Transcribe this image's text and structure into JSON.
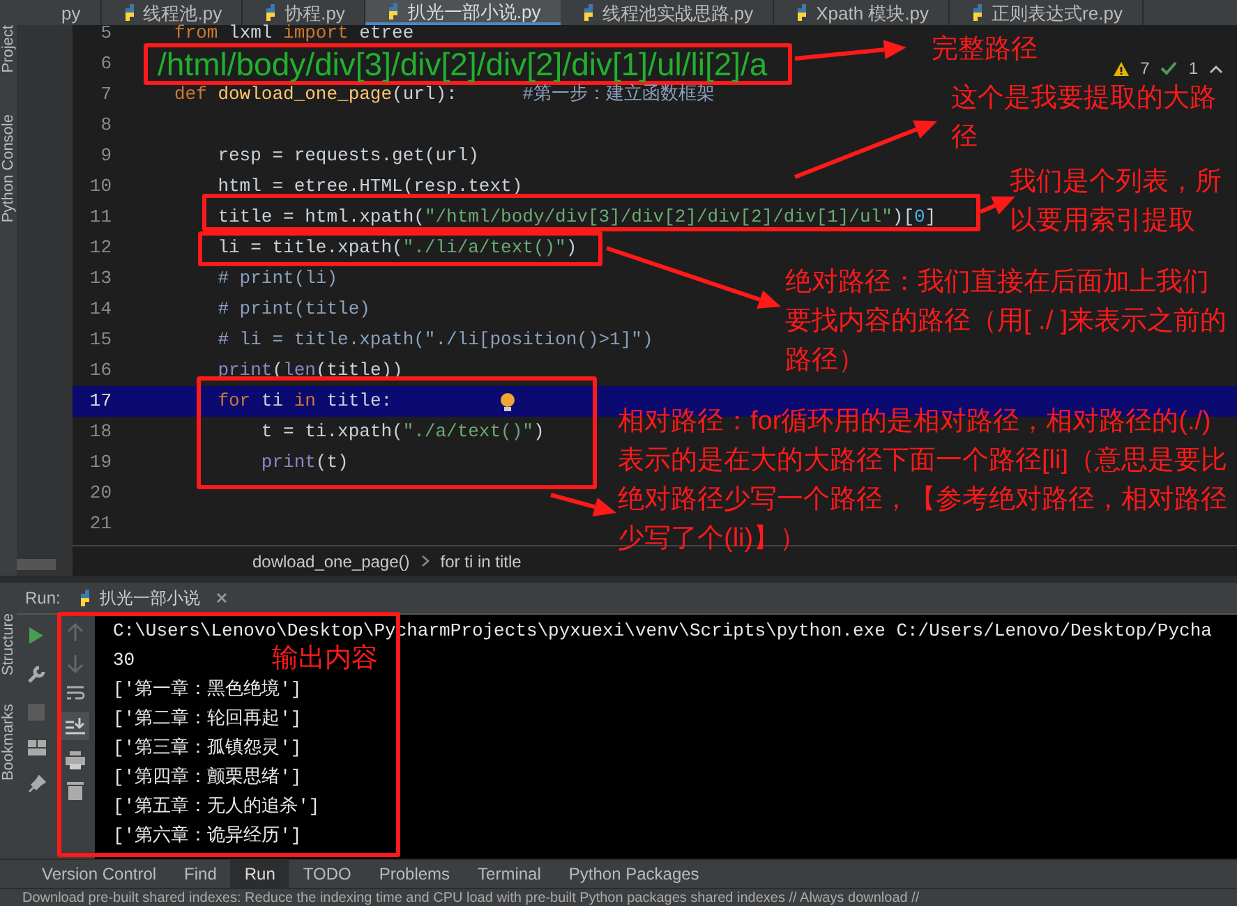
{
  "tabs": [
    {
      "label": "py",
      "selected": false
    },
    {
      "label": "线程池.py",
      "selected": false
    },
    {
      "label": "协程.py",
      "selected": false
    },
    {
      "label": "扒光一部小说.py",
      "selected": true
    },
    {
      "label": "线程池实战思路.py",
      "selected": false
    },
    {
      "label": "Xpath 模块.py",
      "selected": false
    },
    {
      "label": "正则表达式re.py",
      "selected": false
    }
  ],
  "side_labels_top": [
    "Project",
    "Python Console"
  ],
  "inspections": {
    "warnings": "7",
    "passed": "1"
  },
  "code_lines": [
    {
      "number": "5",
      "current": false,
      "segments": [
        {
          "text": "from",
          "kind": "keyword"
        },
        {
          "text": " lxml ",
          "kind": "plain"
        },
        {
          "text": "import",
          "kind": "keyword"
        },
        {
          "text": " etree",
          "kind": "plain"
        }
      ]
    },
    {
      "number": "6",
      "current": false,
      "segments": [
        {
          "text": "/html/body/div[3]/div[2]/div[2]/div[1]/ul/li[2]/a",
          "kind": "annotation"
        }
      ]
    },
    {
      "number": "7",
      "current": false,
      "segments": [
        {
          "text": "def",
          "kind": "keyword"
        },
        {
          "text": " dowload_one_page",
          "kind": "function"
        },
        {
          "text": "(url):",
          "kind": "plain"
        },
        {
          "text": "      #第一步：建立函数框架",
          "kind": "comment"
        }
      ]
    },
    {
      "number": "8",
      "current": false
    },
    {
      "number": "9",
      "current": false,
      "segments": [
        {
          "text": "    resp = requests.get(url)",
          "kind": "plain"
        }
      ]
    },
    {
      "number": "10",
      "current": false,
      "segments": [
        {
          "text": "    html = etree.HTML(resp.text)",
          "kind": "plain"
        }
      ]
    },
    {
      "number": "11",
      "current": false,
      "segments": [
        {
          "text": "    title = html.xpath(",
          "kind": "plain"
        },
        {
          "text": "\"/html/body/div[3]/div[2]/div[2]/div[1]/ul\"",
          "kind": "string"
        },
        {
          "text": ")[",
          "kind": "plain"
        },
        {
          "text": "0",
          "kind": "number"
        },
        {
          "text": "]",
          "kind": "plain"
        }
      ]
    },
    {
      "number": "12",
      "current": false,
      "segments": [
        {
          "text": "    li = title.xpath(",
          "kind": "plain"
        },
        {
          "text": "\"./li/a/text()\"",
          "kind": "string"
        },
        {
          "text": ")",
          "kind": "plain"
        }
      ]
    },
    {
      "number": "13",
      "current": false,
      "segments": [
        {
          "text": "    # print(li)",
          "kind": "comment"
        }
      ]
    },
    {
      "number": "14",
      "current": false,
      "segments": [
        {
          "text": "    # print(title)",
          "kind": "comment"
        }
      ]
    },
    {
      "number": "15",
      "current": false,
      "segments": [
        {
          "text": "    # li = title.xpath(\"./li[position()>1]\")",
          "kind": "comment"
        }
      ]
    },
    {
      "number": "16",
      "current": false,
      "segments": [
        {
          "text": "    print",
          "kind": "builtin"
        },
        {
          "text": "(",
          "kind": "plain"
        },
        {
          "text": "len",
          "kind": "builtin"
        },
        {
          "text": "(title))",
          "kind": "plain"
        }
      ]
    },
    {
      "number": "17",
      "current": true,
      "segments": [
        {
          "text": "    for",
          "kind": "keyword"
        },
        {
          "text": " ti ",
          "kind": "plain"
        },
        {
          "text": "in",
          "kind": "keyword"
        },
        {
          "text": " title:",
          "kind": "plain"
        }
      ]
    },
    {
      "number": "18",
      "current": false,
      "segments": [
        {
          "text": "        t = ti.xpath(",
          "kind": "plain"
        },
        {
          "text": "\"./a/text()\"",
          "kind": "string"
        },
        {
          "text": ")",
          "kind": "plain"
        }
      ]
    },
    {
      "number": "19",
      "current": false,
      "segments": [
        {
          "text": "        print",
          "kind": "builtin"
        },
        {
          "text": "(t)",
          "kind": "plain"
        }
      ]
    },
    {
      "number": "20",
      "current": false
    },
    {
      "number": "21",
      "current": false
    }
  ],
  "breadcrumbs": [
    "dowload_one_page()",
    "for ti in title"
  ],
  "run_panel": {
    "label": "Run:",
    "tab": "扒光一部小说"
  },
  "side_labels_bottom": [
    "Structure",
    "Bookmarks"
  ],
  "console_lines": [
    "C:\\Users\\Lenovo\\Desktop\\PycharmProjects\\pyxuexi\\venv\\Scripts\\python.exe C:/Users/Lenovo/Desktop/Pycha",
    "30",
    "['第一章：黑色绝境']",
    "['第二章：轮回再起']",
    "['第三章：孤镇怨灵']",
    "['第四章：颤栗思绪']",
    "['第五章：无人的追杀']",
    "['第六章：诡异经历']"
  ],
  "tool_windows": [
    {
      "label": "Version Control",
      "selected": false
    },
    {
      "label": "Find",
      "selected": false
    },
    {
      "label": "Run",
      "selected": true
    },
    {
      "label": "TODO",
      "selected": false
    },
    {
      "label": "Problems",
      "selected": false
    },
    {
      "label": "Terminal",
      "selected": false
    },
    {
      "label": "Python Packages",
      "selected": false
    }
  ],
  "status_bar": "Download pre-built shared indexes: Reduce the indexing time and CPU load with pre-built Python packages shared indexes // Always download //",
  "annotations": [
    "完整路径",
    "这个是我要提取的大路径",
    "我们是个列表，所以要用索引提取",
    "绝对路径：我们直接在后面加上我们要找内容的路径（用[ ./ ]来表示之前的路径）",
    "相对路径：for循环用的是相对路径，相对路径的(./)表示的是在大的大路径下面一个路径[li]（意思是要比绝对路径少写一个路径，【参考绝对路径，相对路径少写了个(li)】）",
    "输出内容"
  ]
}
